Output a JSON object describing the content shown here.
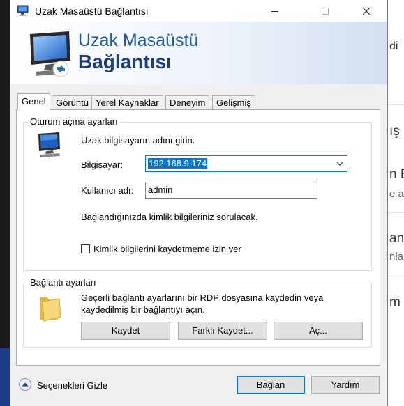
{
  "window": {
    "title": "Uzak Masaüstü Bağlantısı",
    "controls": {
      "minimize": "minimize",
      "maximize": "maximize",
      "close": "close"
    }
  },
  "banner": {
    "line1": "Uzak Masaüstü",
    "line2": "Bağlantısı"
  },
  "tabs": [
    {
      "label": "Genel",
      "active": true
    },
    {
      "label": "Görüntü",
      "active": false
    },
    {
      "label": "Yerel Kaynaklar",
      "active": false
    },
    {
      "label": "Deneyim",
      "active": false
    },
    {
      "label": "Gelişmiş",
      "active": false
    }
  ],
  "logon": {
    "group_title": "Oturum açma ayarları",
    "instruction": "Uzak bilgisayarın adını girin.",
    "computer_label": "Bilgisayar:",
    "computer_value": "192.168.9.174",
    "user_label": "Kullanıcı adı:",
    "user_value": "admin",
    "note": "Bağlandığınızda kimlik bilgileriniz sorulacak.",
    "save_checkbox_label": "Kimlik bilgilerini kaydetmeme izin ver",
    "save_checkbox_checked": false
  },
  "connection": {
    "group_title": "Bağlantı ayarları",
    "desc_line1": "Geçerli bağlantı ayarlarını bir RDP dosyasına kaydedin veya",
    "desc_line2": "kaydedilmiş bir bağlantıyı açın.",
    "save_button": "Kaydet",
    "save_as_button": "Farklı Kaydet...",
    "open_button": "Aç..."
  },
  "footer": {
    "hide_options": "Seçenekleri Gizle",
    "connect_button": "Bağlan",
    "help_button": "Yardım"
  },
  "background": {
    "fragments": [
      "di",
      "ış",
      "n B",
      "e ac",
      "anu",
      "nla",
      "m"
    ]
  },
  "colors": {
    "accent": "#0078d7",
    "banner_text": "#1a5aa8"
  }
}
